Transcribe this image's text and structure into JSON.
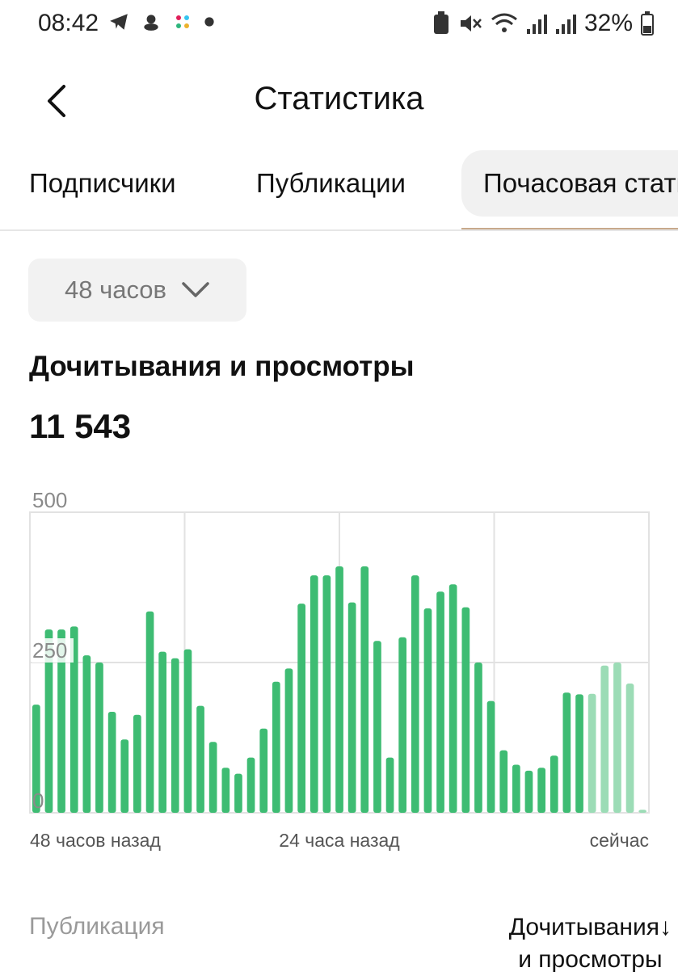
{
  "status_bar": {
    "time": "08:42",
    "battery": "32%",
    "left_icons": [
      "telegram-icon",
      "cat-icon",
      "slack-icon",
      "dot-icon"
    ],
    "right_icons": [
      "battery-saver-icon",
      "mute-icon",
      "wifi-icon",
      "signal-icon",
      "signal-icon-2",
      "battery-icon"
    ]
  },
  "header": {
    "title": "Статистика"
  },
  "tabs": [
    {
      "label": "Подписчики",
      "active": false
    },
    {
      "label": "Публикации",
      "active": false
    },
    {
      "label": "Почасовая статистика",
      "active": true
    }
  ],
  "period": {
    "selected": "48 часов"
  },
  "section": {
    "title": "Дочитывания и просмотры",
    "total": "11 543"
  },
  "chart_data": {
    "type": "bar",
    "yticks": [
      "500",
      "250",
      "0"
    ],
    "ylim": [
      0,
      500
    ],
    "xlabels": [
      "48 часов назад",
      "24 часа назад",
      "сейчас"
    ],
    "grid": true,
    "colors": {
      "main": "#3ebc73",
      "light": "#9cdcb6"
    },
    "values": [
      180,
      305,
      305,
      310,
      262,
      250,
      168,
      122,
      163,
      335,
      268,
      257,
      272,
      178,
      118,
      75,
      65,
      92,
      140,
      218,
      240,
      348,
      395,
      395,
      410,
      350,
      410,
      286,
      92,
      292,
      395,
      340,
      368,
      380,
      342,
      250,
      186,
      104,
      80,
      70,
      75,
      95,
      200,
      197,
      198,
      245,
      250,
      215,
      5
    ],
    "light_from_index": 44
  },
  "table_header": {
    "publication": "Публикация",
    "metric_line1": "Дочитывания↓",
    "metric_line2": "и просмотры"
  }
}
